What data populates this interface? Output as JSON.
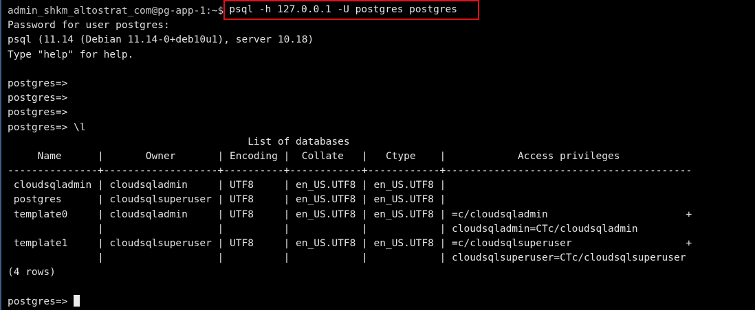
{
  "shell": {
    "prompt": "admin_shkm_altostrat_com@pg-app-1:~$",
    "command": "psql -h 127.0.0.1 -U postgres postgres"
  },
  "output": {
    "password_line": "Password for user postgres:",
    "version_line": "psql (11.14 (Debian 11.14-0+deb10u1), server 10.18)",
    "help_line": "Type \"help\" for help."
  },
  "psql": {
    "prompt": "postgres=>",
    "list_command": "\\l"
  },
  "db_table": {
    "title": "                                        List of databases",
    "header": "     Name      |       Owner       | Encoding |  Collate   |   Ctype    |            Access privileges",
    "separator": "---------------+-------------------+----------+------------+------------+-----------------------------------------",
    "rows": [
      " cloudsqladmin | cloudsqladmin     | UTF8     | en_US.UTF8 | en_US.UTF8 |",
      " postgres      | cloudsqlsuperuser | UTF8     | en_US.UTF8 | en_US.UTF8 |",
      " template0     | cloudsqladmin     | UTF8     | en_US.UTF8 | en_US.UTF8 | =c/cloudsqladmin                       +",
      "               |                   |          |            |            | cloudsqladmin=CTc/cloudsqladmin",
      " template1     | cloudsqlsuperuser | UTF8     | en_US.UTF8 | en_US.UTF8 | =c/cloudsqlsuperuser                   +",
      "               |                   |          |            |            | cloudsqlsuperuser=CTc/cloudsqlsuperuser"
    ],
    "row_count": "(4 rows)"
  },
  "colors": {
    "background": "#000000",
    "text": "#e4e4e4",
    "highlight_box": "#e3101b"
  }
}
